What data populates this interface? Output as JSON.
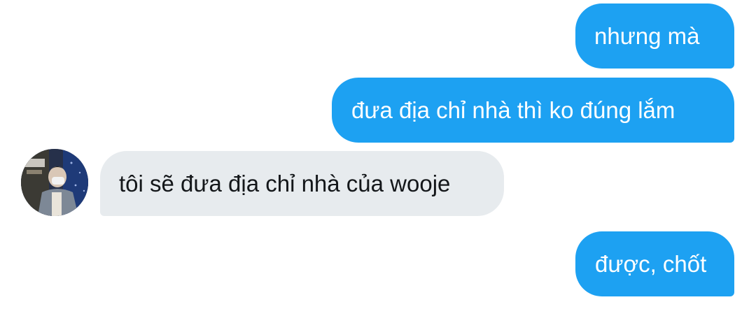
{
  "conversation": {
    "messages": [
      {
        "sender": "me",
        "text": "nhưng mà"
      },
      {
        "sender": "me",
        "text": "đưa địa chỉ nhà thì ko đúng lắm"
      },
      {
        "sender": "them",
        "text": "tôi sẽ đưa địa chỉ nhà của wooje"
      },
      {
        "sender": "me",
        "text": "được, chốt"
      }
    ]
  },
  "colors": {
    "sent_bubble": "#1da1f2",
    "received_bubble": "#e7ebee",
    "sent_text": "#ffffff",
    "received_text": "#14171a"
  },
  "icons": {
    "avatar": "user-avatar-photo"
  }
}
